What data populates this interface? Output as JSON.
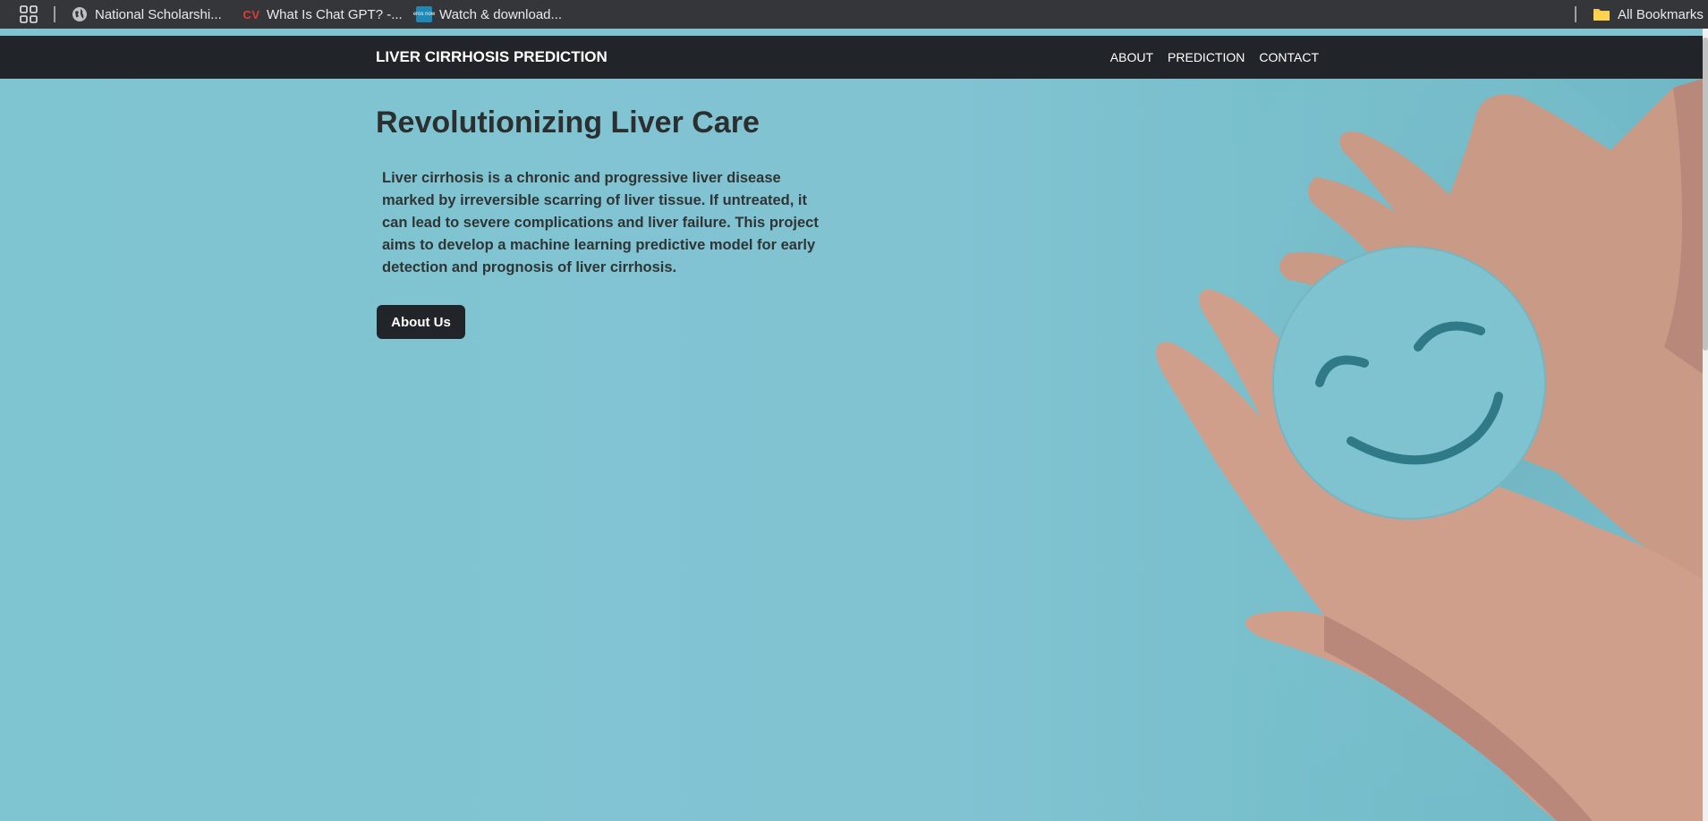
{
  "bookmarks": {
    "items": [
      {
        "label": "National Scholarshi...",
        "icon": "globe-icon"
      },
      {
        "label": "What Is Chat GPT? -...",
        "icon": "cv-icon",
        "icon_text": "CV"
      },
      {
        "label": "Watch & download...",
        "icon": "eros-now-icon",
        "icon_text": "eros now"
      }
    ],
    "all_bookmarks": "All Bookmarks"
  },
  "navbar": {
    "brand": "LIVER CIRRHOSIS PREDICTION",
    "links": [
      "ABOUT",
      "PREDICTION",
      "CONTACT"
    ]
  },
  "hero": {
    "title": "Revolutionizing Liver Care",
    "description": "Liver cirrhosis is a chronic and progressive liver disease marked by irreversible scarring of liver tissue. If untreated, it can lead to severe complications and liver failure. This project aims to develop a machine learning predictive model for early detection and prognosis of liver cirrhosis.",
    "button": "About Us",
    "image": "hands-holding-smiley-face-icon"
  },
  "colors": {
    "navbar": "#212529",
    "hero_bg": "#7fc3d0",
    "text": "#2b2f2f",
    "button": "#212529"
  }
}
